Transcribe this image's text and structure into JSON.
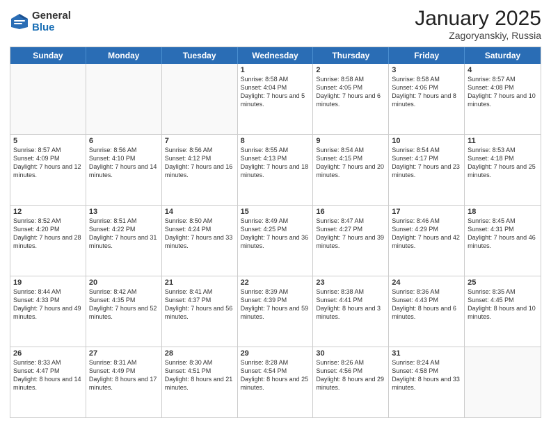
{
  "header": {
    "logo_general": "General",
    "logo_blue": "Blue",
    "title": "January 2025",
    "subtitle": "Zagoryanskiy, Russia"
  },
  "calendar": {
    "days_of_week": [
      "Sunday",
      "Monday",
      "Tuesday",
      "Wednesday",
      "Thursday",
      "Friday",
      "Saturday"
    ],
    "weeks": [
      [
        {
          "num": "",
          "sunrise": "",
          "sunset": "",
          "daylight": "",
          "empty": true
        },
        {
          "num": "",
          "sunrise": "",
          "sunset": "",
          "daylight": "",
          "empty": true
        },
        {
          "num": "",
          "sunrise": "",
          "sunset": "",
          "daylight": "",
          "empty": true
        },
        {
          "num": "1",
          "sunrise": "Sunrise: 8:58 AM",
          "sunset": "Sunset: 4:04 PM",
          "daylight": "Daylight: 7 hours and 5 minutes.",
          "empty": false
        },
        {
          "num": "2",
          "sunrise": "Sunrise: 8:58 AM",
          "sunset": "Sunset: 4:05 PM",
          "daylight": "Daylight: 7 hours and 6 minutes.",
          "empty": false
        },
        {
          "num": "3",
          "sunrise": "Sunrise: 8:58 AM",
          "sunset": "Sunset: 4:06 PM",
          "daylight": "Daylight: 7 hours and 8 minutes.",
          "empty": false
        },
        {
          "num": "4",
          "sunrise": "Sunrise: 8:57 AM",
          "sunset": "Sunset: 4:08 PM",
          "daylight": "Daylight: 7 hours and 10 minutes.",
          "empty": false
        }
      ],
      [
        {
          "num": "5",
          "sunrise": "Sunrise: 8:57 AM",
          "sunset": "Sunset: 4:09 PM",
          "daylight": "Daylight: 7 hours and 12 minutes.",
          "empty": false
        },
        {
          "num": "6",
          "sunrise": "Sunrise: 8:56 AM",
          "sunset": "Sunset: 4:10 PM",
          "daylight": "Daylight: 7 hours and 14 minutes.",
          "empty": false
        },
        {
          "num": "7",
          "sunrise": "Sunrise: 8:56 AM",
          "sunset": "Sunset: 4:12 PM",
          "daylight": "Daylight: 7 hours and 16 minutes.",
          "empty": false
        },
        {
          "num": "8",
          "sunrise": "Sunrise: 8:55 AM",
          "sunset": "Sunset: 4:13 PM",
          "daylight": "Daylight: 7 hours and 18 minutes.",
          "empty": false
        },
        {
          "num": "9",
          "sunrise": "Sunrise: 8:54 AM",
          "sunset": "Sunset: 4:15 PM",
          "daylight": "Daylight: 7 hours and 20 minutes.",
          "empty": false
        },
        {
          "num": "10",
          "sunrise": "Sunrise: 8:54 AM",
          "sunset": "Sunset: 4:17 PM",
          "daylight": "Daylight: 7 hours and 23 minutes.",
          "empty": false
        },
        {
          "num": "11",
          "sunrise": "Sunrise: 8:53 AM",
          "sunset": "Sunset: 4:18 PM",
          "daylight": "Daylight: 7 hours and 25 minutes.",
          "empty": false
        }
      ],
      [
        {
          "num": "12",
          "sunrise": "Sunrise: 8:52 AM",
          "sunset": "Sunset: 4:20 PM",
          "daylight": "Daylight: 7 hours and 28 minutes.",
          "empty": false
        },
        {
          "num": "13",
          "sunrise": "Sunrise: 8:51 AM",
          "sunset": "Sunset: 4:22 PM",
          "daylight": "Daylight: 7 hours and 31 minutes.",
          "empty": false
        },
        {
          "num": "14",
          "sunrise": "Sunrise: 8:50 AM",
          "sunset": "Sunset: 4:24 PM",
          "daylight": "Daylight: 7 hours and 33 minutes.",
          "empty": false
        },
        {
          "num": "15",
          "sunrise": "Sunrise: 8:49 AM",
          "sunset": "Sunset: 4:25 PM",
          "daylight": "Daylight: 7 hours and 36 minutes.",
          "empty": false
        },
        {
          "num": "16",
          "sunrise": "Sunrise: 8:47 AM",
          "sunset": "Sunset: 4:27 PM",
          "daylight": "Daylight: 7 hours and 39 minutes.",
          "empty": false
        },
        {
          "num": "17",
          "sunrise": "Sunrise: 8:46 AM",
          "sunset": "Sunset: 4:29 PM",
          "daylight": "Daylight: 7 hours and 42 minutes.",
          "empty": false
        },
        {
          "num": "18",
          "sunrise": "Sunrise: 8:45 AM",
          "sunset": "Sunset: 4:31 PM",
          "daylight": "Daylight: 7 hours and 46 minutes.",
          "empty": false
        }
      ],
      [
        {
          "num": "19",
          "sunrise": "Sunrise: 8:44 AM",
          "sunset": "Sunset: 4:33 PM",
          "daylight": "Daylight: 7 hours and 49 minutes.",
          "empty": false
        },
        {
          "num": "20",
          "sunrise": "Sunrise: 8:42 AM",
          "sunset": "Sunset: 4:35 PM",
          "daylight": "Daylight: 7 hours and 52 minutes.",
          "empty": false
        },
        {
          "num": "21",
          "sunrise": "Sunrise: 8:41 AM",
          "sunset": "Sunset: 4:37 PM",
          "daylight": "Daylight: 7 hours and 56 minutes.",
          "empty": false
        },
        {
          "num": "22",
          "sunrise": "Sunrise: 8:39 AM",
          "sunset": "Sunset: 4:39 PM",
          "daylight": "Daylight: 7 hours and 59 minutes.",
          "empty": false
        },
        {
          "num": "23",
          "sunrise": "Sunrise: 8:38 AM",
          "sunset": "Sunset: 4:41 PM",
          "daylight": "Daylight: 8 hours and 3 minutes.",
          "empty": false
        },
        {
          "num": "24",
          "sunrise": "Sunrise: 8:36 AM",
          "sunset": "Sunset: 4:43 PM",
          "daylight": "Daylight: 8 hours and 6 minutes.",
          "empty": false
        },
        {
          "num": "25",
          "sunrise": "Sunrise: 8:35 AM",
          "sunset": "Sunset: 4:45 PM",
          "daylight": "Daylight: 8 hours and 10 minutes.",
          "empty": false
        }
      ],
      [
        {
          "num": "26",
          "sunrise": "Sunrise: 8:33 AM",
          "sunset": "Sunset: 4:47 PM",
          "daylight": "Daylight: 8 hours and 14 minutes.",
          "empty": false
        },
        {
          "num": "27",
          "sunrise": "Sunrise: 8:31 AM",
          "sunset": "Sunset: 4:49 PM",
          "daylight": "Daylight: 8 hours and 17 minutes.",
          "empty": false
        },
        {
          "num": "28",
          "sunrise": "Sunrise: 8:30 AM",
          "sunset": "Sunset: 4:51 PM",
          "daylight": "Daylight: 8 hours and 21 minutes.",
          "empty": false
        },
        {
          "num": "29",
          "sunrise": "Sunrise: 8:28 AM",
          "sunset": "Sunset: 4:54 PM",
          "daylight": "Daylight: 8 hours and 25 minutes.",
          "empty": false
        },
        {
          "num": "30",
          "sunrise": "Sunrise: 8:26 AM",
          "sunset": "Sunset: 4:56 PM",
          "daylight": "Daylight: 8 hours and 29 minutes.",
          "empty": false
        },
        {
          "num": "31",
          "sunrise": "Sunrise: 8:24 AM",
          "sunset": "Sunset: 4:58 PM",
          "daylight": "Daylight: 8 hours and 33 minutes.",
          "empty": false
        },
        {
          "num": "",
          "sunrise": "",
          "sunset": "",
          "daylight": "",
          "empty": true
        }
      ]
    ]
  }
}
